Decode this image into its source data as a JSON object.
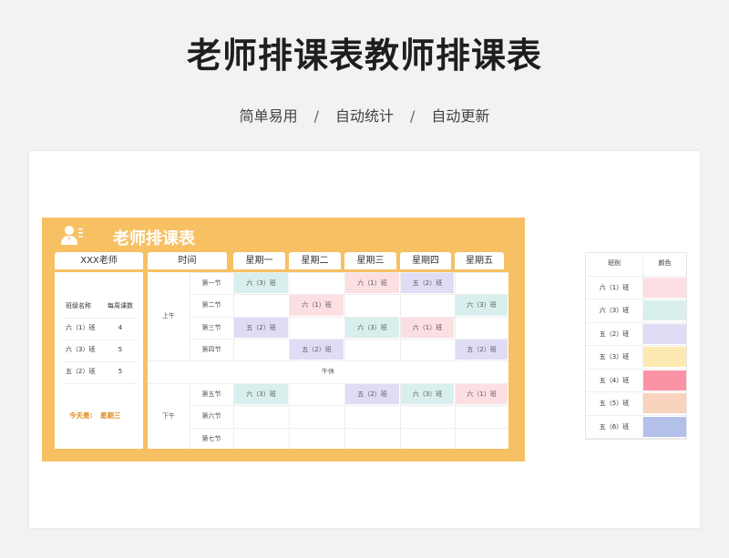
{
  "page": {
    "title": "老师排课表教师排课表",
    "subtitle": [
      "简单易用",
      "/",
      "自动统计",
      "/",
      "自动更新"
    ]
  },
  "panel": {
    "title": "老师排课表",
    "teacher_header": "XXX老师",
    "time_header": "时间",
    "days": [
      "星期一",
      "星期二",
      "星期三",
      "星期四",
      "星期五"
    ]
  },
  "summary": {
    "col_class": "班级名称",
    "col_count": "每周课数",
    "rows": [
      {
        "class": "六（1）班",
        "count": "4"
      },
      {
        "class": "六（3）班",
        "count": "5"
      },
      {
        "class": "五（2）班",
        "count": "5"
      }
    ],
    "today_label": "今天是:",
    "today_value": "星期三"
  },
  "schedule": {
    "morning": "上午",
    "afternoon": "下午",
    "noon_break": "午休",
    "morning_periods": [
      "第一节",
      "第二节",
      "第三节",
      "第四节"
    ],
    "afternoon_periods": [
      "第五节",
      "第六节",
      "第七节"
    ],
    "morning_cells": [
      [
        "六（3）班",
        "",
        "六（1）班",
        "五（2）班",
        ""
      ],
      [
        "",
        "六（1）班",
        "",
        "",
        "六（3）班"
      ],
      [
        "五（2）班",
        "",
        "六（3）班",
        "六（1）班",
        ""
      ],
      [
        "",
        "五（2）班",
        "",
        "",
        "五（2）班"
      ]
    ],
    "afternoon_cells": [
      [
        "六（3）班",
        "",
        "五（2）班",
        "六（3）班",
        "六（1）班"
      ],
      [
        "",
        "",
        "",
        "",
        ""
      ],
      [
        "",
        "",
        "",
        "",
        ""
      ]
    ]
  },
  "legend": {
    "col_class": "班别",
    "col_color": "颜色",
    "rows": [
      {
        "class": "六（1）班",
        "color": "#fbdfe2"
      },
      {
        "class": "六（3）班",
        "color": "#d8efed"
      },
      {
        "class": "五（2）班",
        "color": "#e0dcf6"
      },
      {
        "class": "五（3）班",
        "color": "#fdeab2"
      },
      {
        "class": "五（4）班",
        "color": "#fb93a6"
      },
      {
        "class": "五（5）班",
        "color": "#f8d3bd"
      },
      {
        "class": "五（6）班",
        "color": "#b2c0ea"
      }
    ]
  },
  "colors": {
    "panel": "#f7c063",
    "accent_text": "#e08a1a"
  }
}
